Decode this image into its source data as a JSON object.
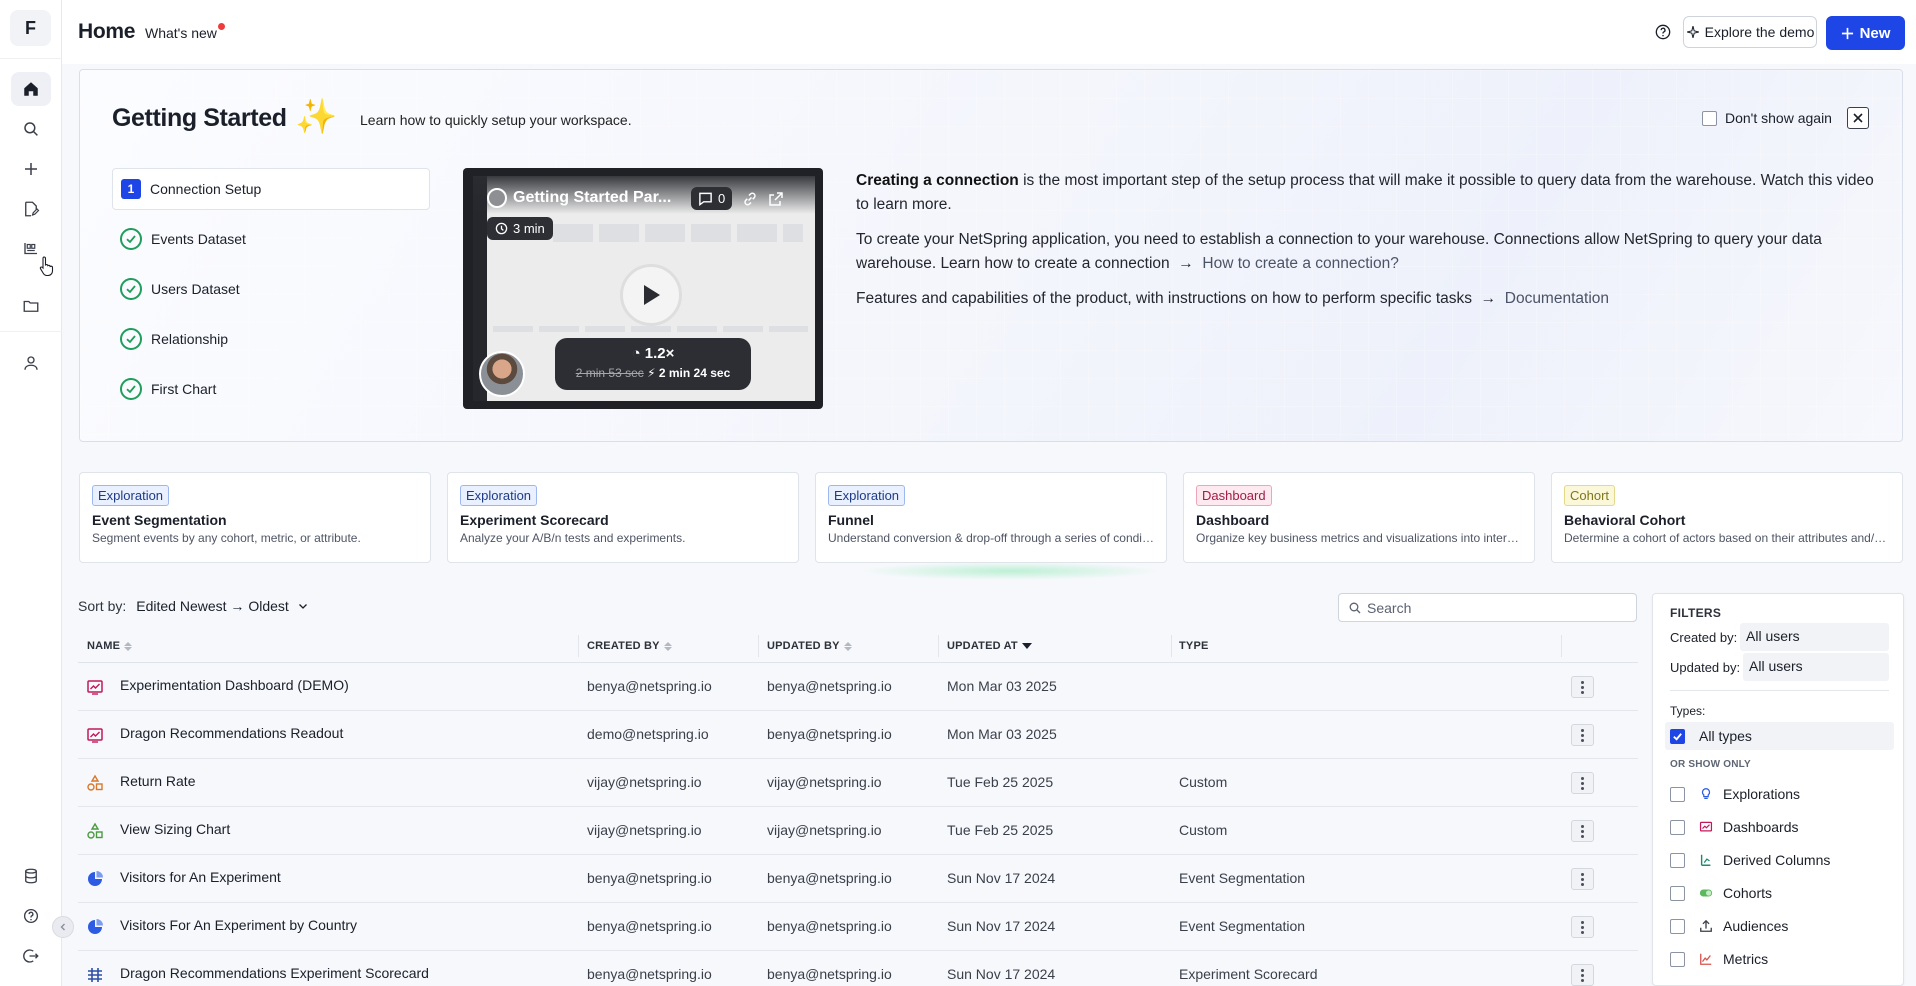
{
  "app": {
    "logo_letter": "F"
  },
  "header": {
    "title": "Home",
    "whats_new": "What's new",
    "explore_demo": "Explore the demo",
    "new_button": "New"
  },
  "getting_started": {
    "title": "Getting Started",
    "subtitle": "Learn how to quickly setup your workspace.",
    "dont_show": "Don't show again",
    "steps": [
      {
        "num": "1",
        "label": "Connection Setup",
        "state": "active"
      },
      {
        "label": "Events Dataset",
        "state": "done"
      },
      {
        "label": "Users Dataset",
        "state": "done"
      },
      {
        "label": "Relationship",
        "state": "done"
      },
      {
        "label": "First Chart",
        "state": "done"
      }
    ],
    "video": {
      "title": "Getting Started Par...",
      "comments": "0",
      "duration": "3 min",
      "speed": "1.2×",
      "old_time": "2 min 53 sec",
      "new_time": "2 min 24 sec"
    },
    "para1_bold": "Creating a connection",
    "para1_rest": " is the most important step of the setup process that will make it possible to query data from the warehouse. Watch this video to learn more.",
    "para2": "To create your NetSpring application, you need to establish a connection to your warehouse. Connections allow NetSpring to query your data warehouse. Learn how to create a connection",
    "para2_link": "How to create a connection?",
    "para3": "Features and capabilities of the product, with instructions on how to perform specific tasks",
    "para3_link": "Documentation"
  },
  "templates": [
    {
      "tag": "Exploration",
      "kind": "exp",
      "title": "Event Segmentation",
      "desc": "Segment events by any cohort, metric, or attribute."
    },
    {
      "tag": "Exploration",
      "kind": "exp",
      "title": "Experiment Scorecard",
      "desc": "Analyze your A/B/n tests and experiments."
    },
    {
      "tag": "Exploration",
      "kind": "exp",
      "title": "Funnel",
      "desc": "Understand conversion & drop-off through a series of conditi..."
    },
    {
      "tag": "Dashboard",
      "kind": "dash",
      "title": "Dashboard",
      "desc": "Organize key business metrics and visualizations into interacti..."
    },
    {
      "tag": "Cohort",
      "kind": "coh",
      "title": "Behavioral Cohort",
      "desc": "Determine a cohort of actors based on their attributes and/or ..."
    }
  ],
  "list": {
    "sort_label": "Sort by:",
    "sort_value": "Edited Newest",
    "sort_to": "Oldest",
    "search_placeholder": "Search",
    "columns": {
      "name": "NAME",
      "created_by": "CREATED BY",
      "updated_by": "UPDATED BY",
      "updated_at": "UPDATED AT",
      "type": "TYPE"
    },
    "rows": [
      {
        "icon": "dashboard-icon",
        "name": "Experimentation Dashboard (DEMO)",
        "created_by": "benya@netspring.io",
        "updated_by": "benya@netspring.io",
        "updated_at": "Mon Mar 03 2025",
        "type": ""
      },
      {
        "icon": "dashboard-icon",
        "name": "Dragon Recommendations Readout",
        "created_by": "demo@netspring.io",
        "updated_by": "benya@netspring.io",
        "updated_at": "Mon Mar 03 2025",
        "type": ""
      },
      {
        "icon": "custom-metric-icon",
        "name": "Return Rate",
        "created_by": "vijay@netspring.io",
        "updated_by": "vijay@netspring.io",
        "updated_at": "Tue Feb 25 2025",
        "type": "Custom"
      },
      {
        "icon": "custom-metric-icon",
        "name": "View Sizing Chart",
        "created_by": "vijay@netspring.io",
        "updated_by": "vijay@netspring.io",
        "updated_at": "Tue Feb 25 2025",
        "type": "Custom"
      },
      {
        "icon": "segmentation-icon",
        "name": "Visitors for An Experiment",
        "created_by": "benya@netspring.io",
        "updated_by": "benya@netspring.io",
        "updated_at": "Sun Nov 17 2024",
        "type": "Event Segmentation"
      },
      {
        "icon": "segmentation-icon",
        "name": "Visitors For An Experiment by Country",
        "created_by": "benya@netspring.io",
        "updated_by": "benya@netspring.io",
        "updated_at": "Sun Nov 17 2024",
        "type": "Event Segmentation"
      },
      {
        "icon": "scorecard-icon",
        "name": "Dragon Recommendations Experiment Scorecard",
        "created_by": "benya@netspring.io",
        "updated_by": "benya@netspring.io",
        "updated_at": "Sun Nov 17 2024",
        "type": "Experiment Scorecard"
      }
    ]
  },
  "filters": {
    "title": "FILTERS",
    "created_by_label": "Created by:",
    "created_by_value": "All users",
    "updated_by_label": "Updated by:",
    "updated_by_value": "All users",
    "types_label": "Types:",
    "all_types": "All types",
    "or_show_only": "OR SHOW ONLY",
    "options": [
      "Explorations",
      "Dashboards",
      "Derived Columns",
      "Cohorts",
      "Audiences",
      "Metrics"
    ]
  },
  "colors": {
    "accent": "#1e45e6",
    "done": "#1f9d5c",
    "dashboard": "#c2185b"
  }
}
